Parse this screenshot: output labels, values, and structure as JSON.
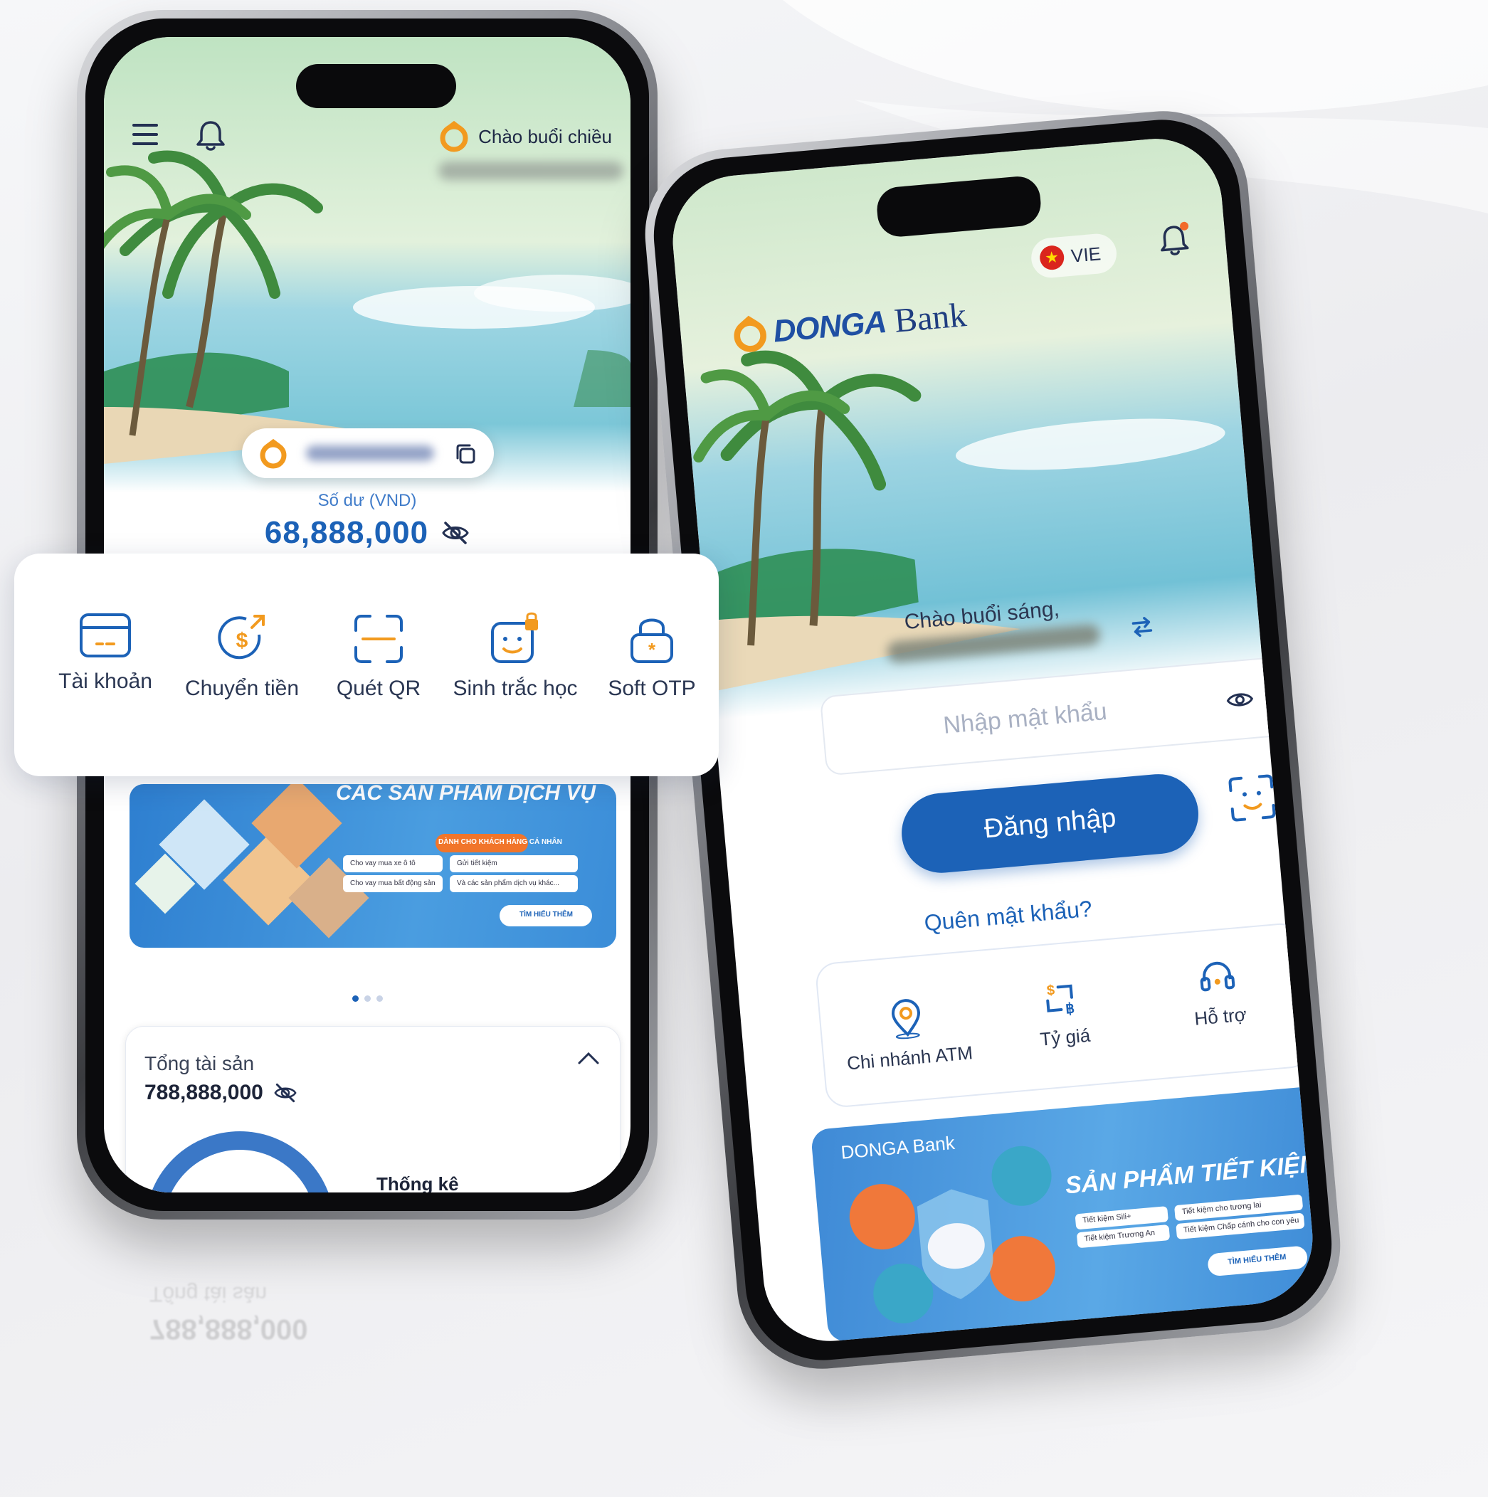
{
  "left_phone": {
    "greeting": "Chào buổi chiều",
    "balance_label": "Số dư (VND)",
    "balance_value": "68,888,000",
    "quick_actions": [
      {
        "label": "Tài khoản",
        "icon": "card-icon"
      },
      {
        "label": "Chuyển tiền",
        "icon": "transfer-icon"
      },
      {
        "label": "Quét QR",
        "icon": "qr-scan-icon"
      },
      {
        "label": "Sinh trắc học",
        "icon": "biometric-icon"
      },
      {
        "label": "Soft OTP",
        "icon": "lock-icon"
      }
    ],
    "promo": {
      "title": "CÁC SẢN PHẨM DỊCH VỤ",
      "subtitle": "DÀNH CHO KHÁCH HÀNG CÁ NHÂN",
      "bullets": [
        "Cho vay mua xe ô tô",
        "Gửi tiết kiệm",
        "Cho vay mua bất động sản",
        "Và các sản phẩm dịch vụ khác..."
      ],
      "cta": "TÌM HIỂU THÊM"
    },
    "assets": {
      "title": "Tổng tài sản",
      "value": "788,888,000",
      "stats_label": "Thống kê"
    }
  },
  "right_phone": {
    "language": "VIE",
    "brand": {
      "name": "DONGA",
      "suffix": "Bank"
    },
    "greeting": "Chào buổi sáng,",
    "password_placeholder": "Nhập mật khẩu",
    "login_label": "Đăng nhập",
    "forgot_label": "Quên mật khẩu?",
    "services": [
      {
        "label": "Chi nhánh ATM",
        "icon": "location-pin-icon"
      },
      {
        "label": "Tỷ giá",
        "icon": "exchange-rate-icon"
      },
      {
        "label": "Hỗ trợ",
        "icon": "headset-icon"
      }
    ],
    "promo": {
      "brand": "DONGA Bank",
      "title": "SẢN PHẨM TIẾT KIỆM",
      "bullets": [
        "Tiết kiệm Sili+",
        "Tiết kiệm cho tương lai",
        "Tiết kiệm Trương An",
        "Tiết kiệm Chấp cánh cho con yêu"
      ],
      "cta": "TÌM HIỂU THÊM"
    }
  },
  "colors": {
    "primary_blue": "#1c62b7",
    "brand_orange": "#f29a1f",
    "text_dark": "#1f2a44"
  }
}
